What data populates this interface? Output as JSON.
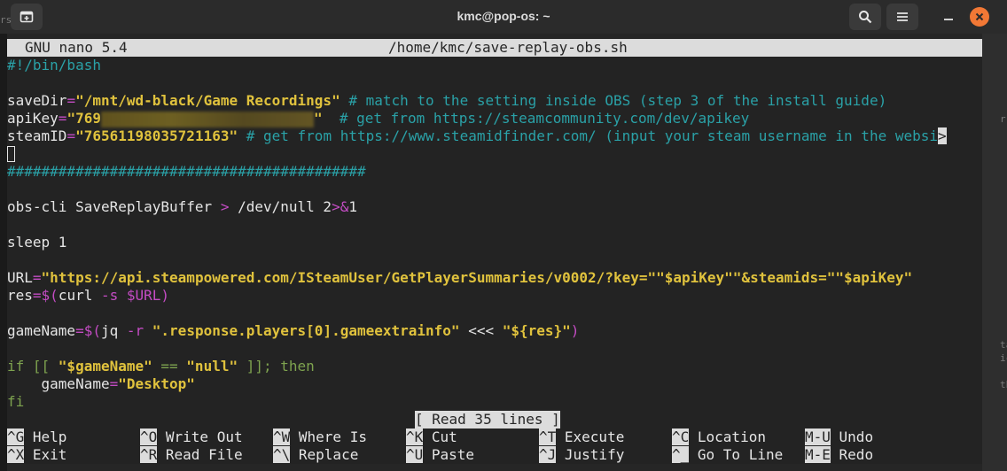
{
  "window": {
    "title": "kmc@pop-os: ~",
    "icons": {
      "new_tab": "new-tab-icon",
      "search": "search-icon",
      "menu": "hamburger-menu-icon",
      "minimize": "minimize-icon",
      "close": "close-icon"
    },
    "colors": {
      "close": "#f27835",
      "titlebar": "#2b2b2b"
    }
  },
  "background_strips": {
    "left": [
      "rs"
    ],
    "right": [
      "r:",
      "ta",
      "ic",
      "th"
    ]
  },
  "nano": {
    "version": "GNU nano 5.4",
    "filepath": "/home/kmc/save-replay-obs.sh",
    "status": "[ Read 35 lines ]",
    "code": {
      "shebang": "#!/bin/bash",
      "saveDir_name": "saveDir",
      "saveDir_eq": "=",
      "saveDir_val": "\"/mnt/wd-black/Game Recordings\"",
      "saveDir_comment": " # match to the setting inside OBS (step 3 of the install guide)",
      "apiKey_name": "apiKey",
      "apiKey_eq": "=",
      "apiKey_val_start": "\"769",
      "apiKey_val_end": "\"",
      "apiKey_comment": "  # get from https://steamcommunity.com/dev/apikey",
      "steamID_name": "steamID",
      "steamID_eq": "=",
      "steamID_val": "\"76561198035721163\"",
      "steamID_comment": " # get from https://www.steamidfinder.com/ (input your steam username in the websi",
      "steamID_overflow": ">",
      "hashes": "##########################################",
      "obs_cmd": "obs-cli SaveReplayBuffer ",
      "obs_redirect": ">",
      "obs_null": " /dev/null 2",
      "obs_amp": ">&",
      "obs_one": "1",
      "sleep": "sleep 1",
      "url_name": "URL",
      "url_eq": "=",
      "url_val": "\"https://api.steampowered.com/ISteamUser/GetPlayerSummaries/v0002/?key=\"\"$apiKey\"\"&steamids=\"\"$apiKey\"",
      "res_name": "res",
      "res_eq": "=",
      "res_open": "$(",
      "res_curl": "curl ",
      "res_flag": "-s",
      "res_space": " ",
      "res_var": "$URL",
      "res_close": ")",
      "gn_name": "gameName",
      "gn_eq": "=",
      "gn_open": "$(",
      "gn_jq": "jq ",
      "gn_flag": "-r",
      "gn_space": " ",
      "gn_expr": "\".response.players[0].gameextrainfo\"",
      "gn_heredoc": " <<< ",
      "gn_res": "\"${res}\"",
      "gn_close": ")",
      "if_kw": "if [[ ",
      "if_var": "\"$gameName\"",
      "if_op": " == ",
      "if_null": "\"null\"",
      "if_end": " ]]; then",
      "desk_name": "    gameName",
      "desk_eq": "=",
      "desk_val": "\"Desktop\"",
      "fi": "fi"
    },
    "shortcuts": [
      {
        "key": "^G",
        "label": " Help"
      },
      {
        "key": "^O",
        "label": " Write Out"
      },
      {
        "key": "^W",
        "label": " Where Is"
      },
      {
        "key": "^K",
        "label": " Cut"
      },
      {
        "key": "^T",
        "label": " Execute"
      },
      {
        "key": "^C",
        "label": " Location"
      },
      {
        "key": "M-U",
        "label": " Undo"
      },
      {
        "key": "^X",
        "label": " Exit"
      },
      {
        "key": "^R",
        "label": " Read File"
      },
      {
        "key": "^\\",
        "label": " Replace"
      },
      {
        "key": "^U",
        "label": " Paste"
      },
      {
        "key": "^J",
        "label": " Justify"
      },
      {
        "key": "^_",
        "label": " Go To Line"
      },
      {
        "key": "M-E",
        "label": " Redo"
      }
    ]
  }
}
